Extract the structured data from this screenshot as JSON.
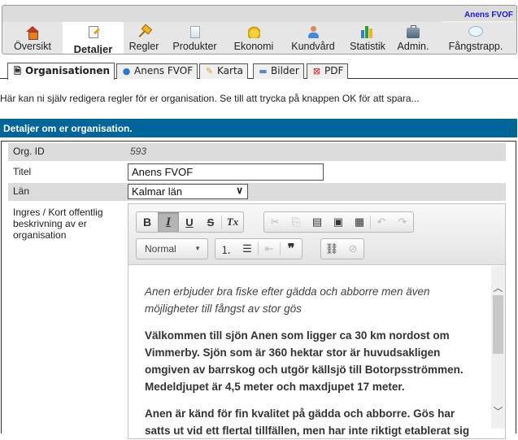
{
  "header": {
    "org_name": "Anens FVOF",
    "nav": [
      {
        "label": "Översikt",
        "icon": "house-icon",
        "active": false
      },
      {
        "label": "Detaljer",
        "icon": "edit-document-icon",
        "active": true
      },
      {
        "label": "Regler",
        "icon": "gavel-icon",
        "active": false
      },
      {
        "label": "Produkter",
        "icon": "page-icon",
        "active": false
      },
      {
        "label": "Ekonomi",
        "icon": "coins-icon",
        "active": false
      },
      {
        "label": "Kundvård",
        "icon": "user-icon",
        "active": false
      },
      {
        "label": "Statistik",
        "icon": "bar-chart-icon",
        "active": false
      },
      {
        "label": "Admin.",
        "icon": "briefcase-icon",
        "active": false
      },
      {
        "label": "Fångstrapp.",
        "icon": "speech-bubble-icon",
        "active": false
      }
    ]
  },
  "tabs": [
    {
      "label": "Organisationen",
      "icon": "document-icon",
      "active": true
    },
    {
      "label": "Anens FVOF",
      "icon": "globe-icon",
      "active": false
    },
    {
      "label": "Karta",
      "icon": "map-pin-icon",
      "active": false
    },
    {
      "label": "Bilder",
      "icon": "image-icon",
      "active": false
    },
    {
      "label": "PDF",
      "icon": "pdf-icon",
      "active": false
    }
  ],
  "intro_text": "Här kan ni själv redigera regler för er organisation. Se till att trycka på knappen OK för att spara...",
  "section": {
    "title": "Detaljer om er organisation.",
    "fields": {
      "org_id_label": "Org. ID",
      "org_id_value": "593",
      "title_label": "Titel",
      "title_value": "Anens FVOF",
      "county_label": "Län",
      "county_value": "Kalmar län",
      "description_label": "Ingres / Kort offentlig beskrivning av er organisation"
    }
  },
  "editor": {
    "toolbar": {
      "bold": "B",
      "italic": "I",
      "underline": "U",
      "strike": "S",
      "remove_format": "Tx",
      "format_value": "Normal",
      "blockquote": "❞"
    },
    "content": {
      "lead": "Anen erbjuder bra fiske efter gädda och abborre men även möjligheter till fångst av stor gös",
      "p1": "Välkommen till sjön Anen som ligger ca 30 km nordost om Vimmerby. Sjön som är 360 hektar stor är huvudsakligen omgiven av barrskog och utgör källsjö till Botorpsströmmen. Medeldjupet är 4,5 meter och maxdjupet 17 meter.",
      "p2": "Anen är känd för fin kvalitet på gädda och abborre. Gös har satts ut vid ett flertal tillfällen, men har inte riktigt etablerat sig"
    }
  },
  "colors": {
    "section_header_bg": "#006699",
    "org_name": "#1a1ad6",
    "row_shade": "#dcdcdc"
  }
}
